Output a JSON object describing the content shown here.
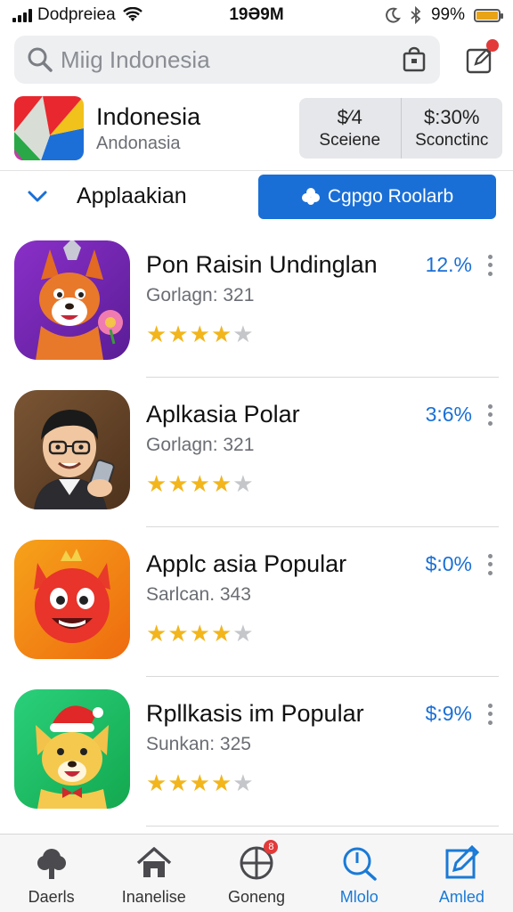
{
  "status_bar": {
    "carrier": "Dodpreiea",
    "time": "19Ə9M",
    "battery": "99%",
    "battery_level": 0.99
  },
  "search": {
    "placeholder": "Miig Indonesia"
  },
  "country": {
    "name": "Indonesia",
    "subtitle": "Andonasia",
    "stats": [
      {
        "value": "$⁄4",
        "label": "Sceiene"
      },
      {
        "value": "$:30%",
        "label": "Sconctinc"
      }
    ]
  },
  "filter": {
    "label": "Applaakian",
    "button_label": "Cgpgo Roolarb"
  },
  "apps": [
    {
      "title": "Pon Raisin Undinglan",
      "meta": "Gorlagn: 321",
      "percent": "12.%",
      "rating": 4,
      "rating_max": 5,
      "icon": "fox-mascot-icon",
      "icon_bg": "#7a2bb8"
    },
    {
      "title": "Aplkasia Polar",
      "meta": "Gorlagn: 321",
      "percent": "3:6%",
      "rating": 4,
      "rating_max": 5,
      "icon": "man-with-phone-icon",
      "icon_bg": "#6b4a2e"
    },
    {
      "title": "Applc asia Popular",
      "meta": "Sarlcan. 343",
      "percent": "$:0%",
      "rating": 4,
      "rating_max": 5,
      "icon": "red-devil-mascot-icon",
      "icon_bg": "#f28a10"
    },
    {
      "title": "Rpllkasis im Popular",
      "meta": "Sunkan: 325",
      "percent": "$:9%",
      "rating": 4,
      "rating_max": 5,
      "icon": "dog-santa-hat-icon",
      "icon_bg": "#1fbf63"
    }
  ],
  "tabs": [
    {
      "label": "Daerls",
      "icon": "tree-icon",
      "active": false
    },
    {
      "label": "Inanelise",
      "icon": "home-icon",
      "active": false
    },
    {
      "label": "Goneng",
      "icon": "globe-icon",
      "active": false,
      "badge": "8"
    },
    {
      "label": "Mlolo",
      "icon": "search-icon",
      "active": true
    },
    {
      "label": "Amled",
      "icon": "edit-icon",
      "active": true
    }
  ],
  "colors": {
    "accent": "#1a6fd6",
    "star": "#f2b51c",
    "badge": "#e23a3a"
  }
}
